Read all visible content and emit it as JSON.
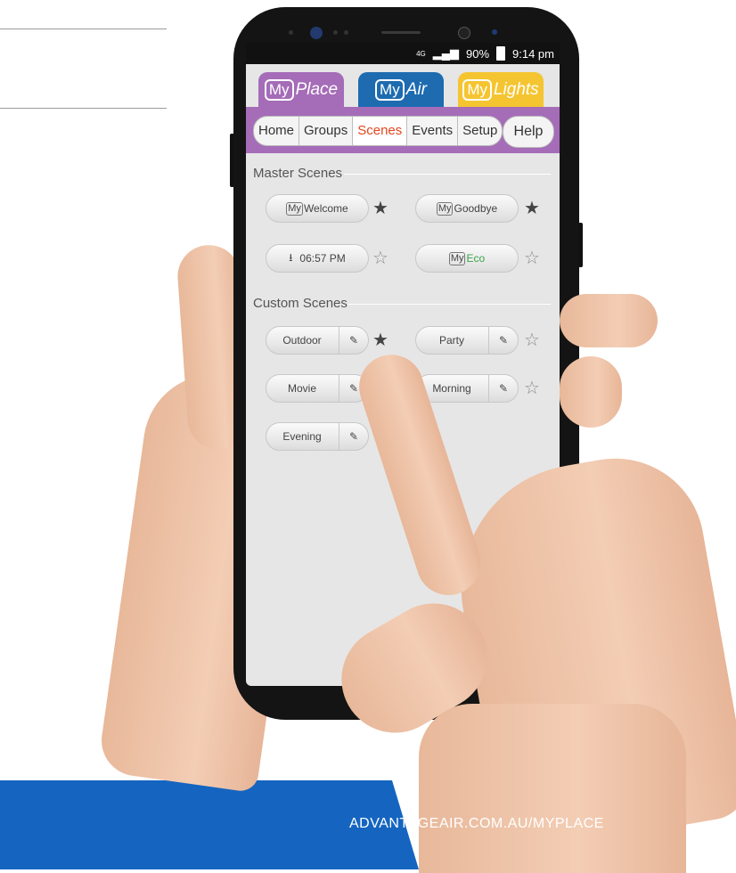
{
  "page": {
    "footer_url": "ADVANTAGEAIR.COM.AU/MYPLACE"
  },
  "status_bar": {
    "network": "4G",
    "battery": "90%",
    "time": "9:14 pm"
  },
  "brands": [
    {
      "my": "My",
      "name": "Place",
      "color": "#a56cb8"
    },
    {
      "my": "My",
      "name": "Air",
      "color": "#1e6bb0"
    },
    {
      "my": "My",
      "name": "Lights",
      "color": "#f5c531"
    }
  ],
  "nav": {
    "tabs": [
      "Home",
      "Groups",
      "Scenes",
      "Events",
      "Setup"
    ],
    "active_tab": "Scenes",
    "help": "Help"
  },
  "master_scenes": {
    "title": "Master Scenes",
    "items": [
      {
        "my": "My",
        "label": "Welcome",
        "favourite": true
      },
      {
        "my": "My",
        "label": "Goodbye",
        "favourite": true
      },
      {
        "label": "06:57 PM",
        "icon": "sunset-icon",
        "favourite": false
      },
      {
        "my": "My",
        "label": "Eco",
        "favourite": false
      }
    ]
  },
  "custom_scenes": {
    "title": "Custom Scenes",
    "items": [
      {
        "label": "Outdoor",
        "favourite": true
      },
      {
        "label": "Party",
        "favourite": false
      },
      {
        "label": "Movie",
        "favourite": false
      },
      {
        "label": "Morning",
        "favourite": false
      },
      {
        "label": "Evening",
        "favourite": false
      }
    ]
  },
  "icons": {
    "edit": "pencil-icon",
    "star_full": "star-filled-icon",
    "star_empty": "star-outline-icon"
  },
  "colors": {
    "active_tab": "#e2471d",
    "nav_bar": "#a56cb8",
    "footer": "#1565c0",
    "eco": "#3aa54a"
  }
}
